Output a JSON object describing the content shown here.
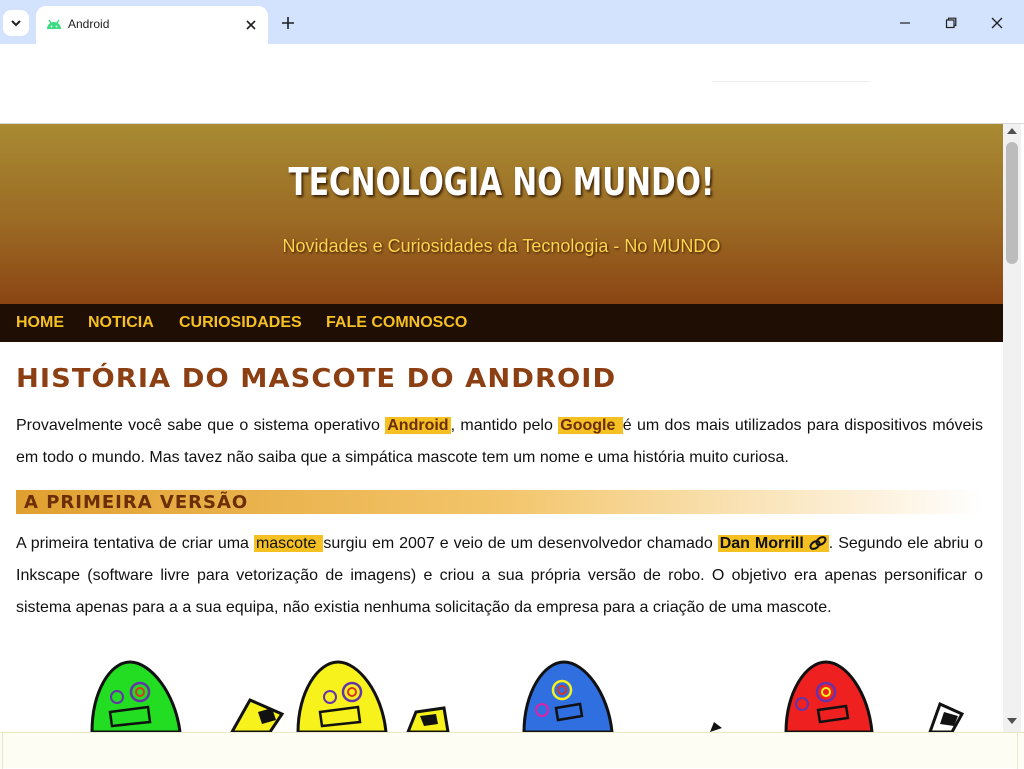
{
  "browser": {
    "tab_title": "Android",
    "colors": {
      "tabbar": "#d3e3fd",
      "favicon": "#3ddc84"
    }
  },
  "site": {
    "title": "TECNOLOGIA NO MUNDO!",
    "subtitle": "Novidades e Curiosidades da Tecnologia - No MUNDO",
    "colors": {
      "header_top": "#a88a32",
      "header_bottom": "#8b4513",
      "nav_bg": "#1f0e03",
      "nav_text": "#f4c022",
      "highlight": "#f4c022"
    }
  },
  "nav": {
    "items": [
      {
        "label": "HOME"
      },
      {
        "label": "NOTICIA"
      },
      {
        "label": "CURIOSIDADES"
      },
      {
        "label": "FALE COMNOSCO"
      }
    ]
  },
  "article": {
    "heading": "HISTÓRIA DO MASCOTE DO ANDROID",
    "p1": {
      "t1": "Provavelmente você sabe que o sistema operativo ",
      "hl1": "Android",
      "t2": ", mantido pelo ",
      "hl2": "Google ",
      "t3": "é um dos mais utilizados para dispositivos móveis em todo o mundo. Mas tavez não saiba que a simpática mascote tem um nome e uma história muito curiosa."
    },
    "section_heading": "A PRIMEIRA VERSÃO",
    "p2": {
      "t1": "A primeira tentativa de criar uma ",
      "hl1": "mascote ",
      "t2": "surgiu em 2007 e veio de um desenvolvedor chamado ",
      "hl2": "Dan Morrill",
      "t3": ". Segundo ele abriu o Inkscape (software livre para vetorização de imagens) e criou a sua própria versão de robo. O objetivo era apenas personificar o sistema apenas para a a sua equipa, não existia nenhuma solicitação da empresa para a criação de uma mascote."
    },
    "mascot_colors": [
      "#22dd22",
      "#f7f21c",
      "#2f6fe0",
      "#ee2020"
    ]
  }
}
